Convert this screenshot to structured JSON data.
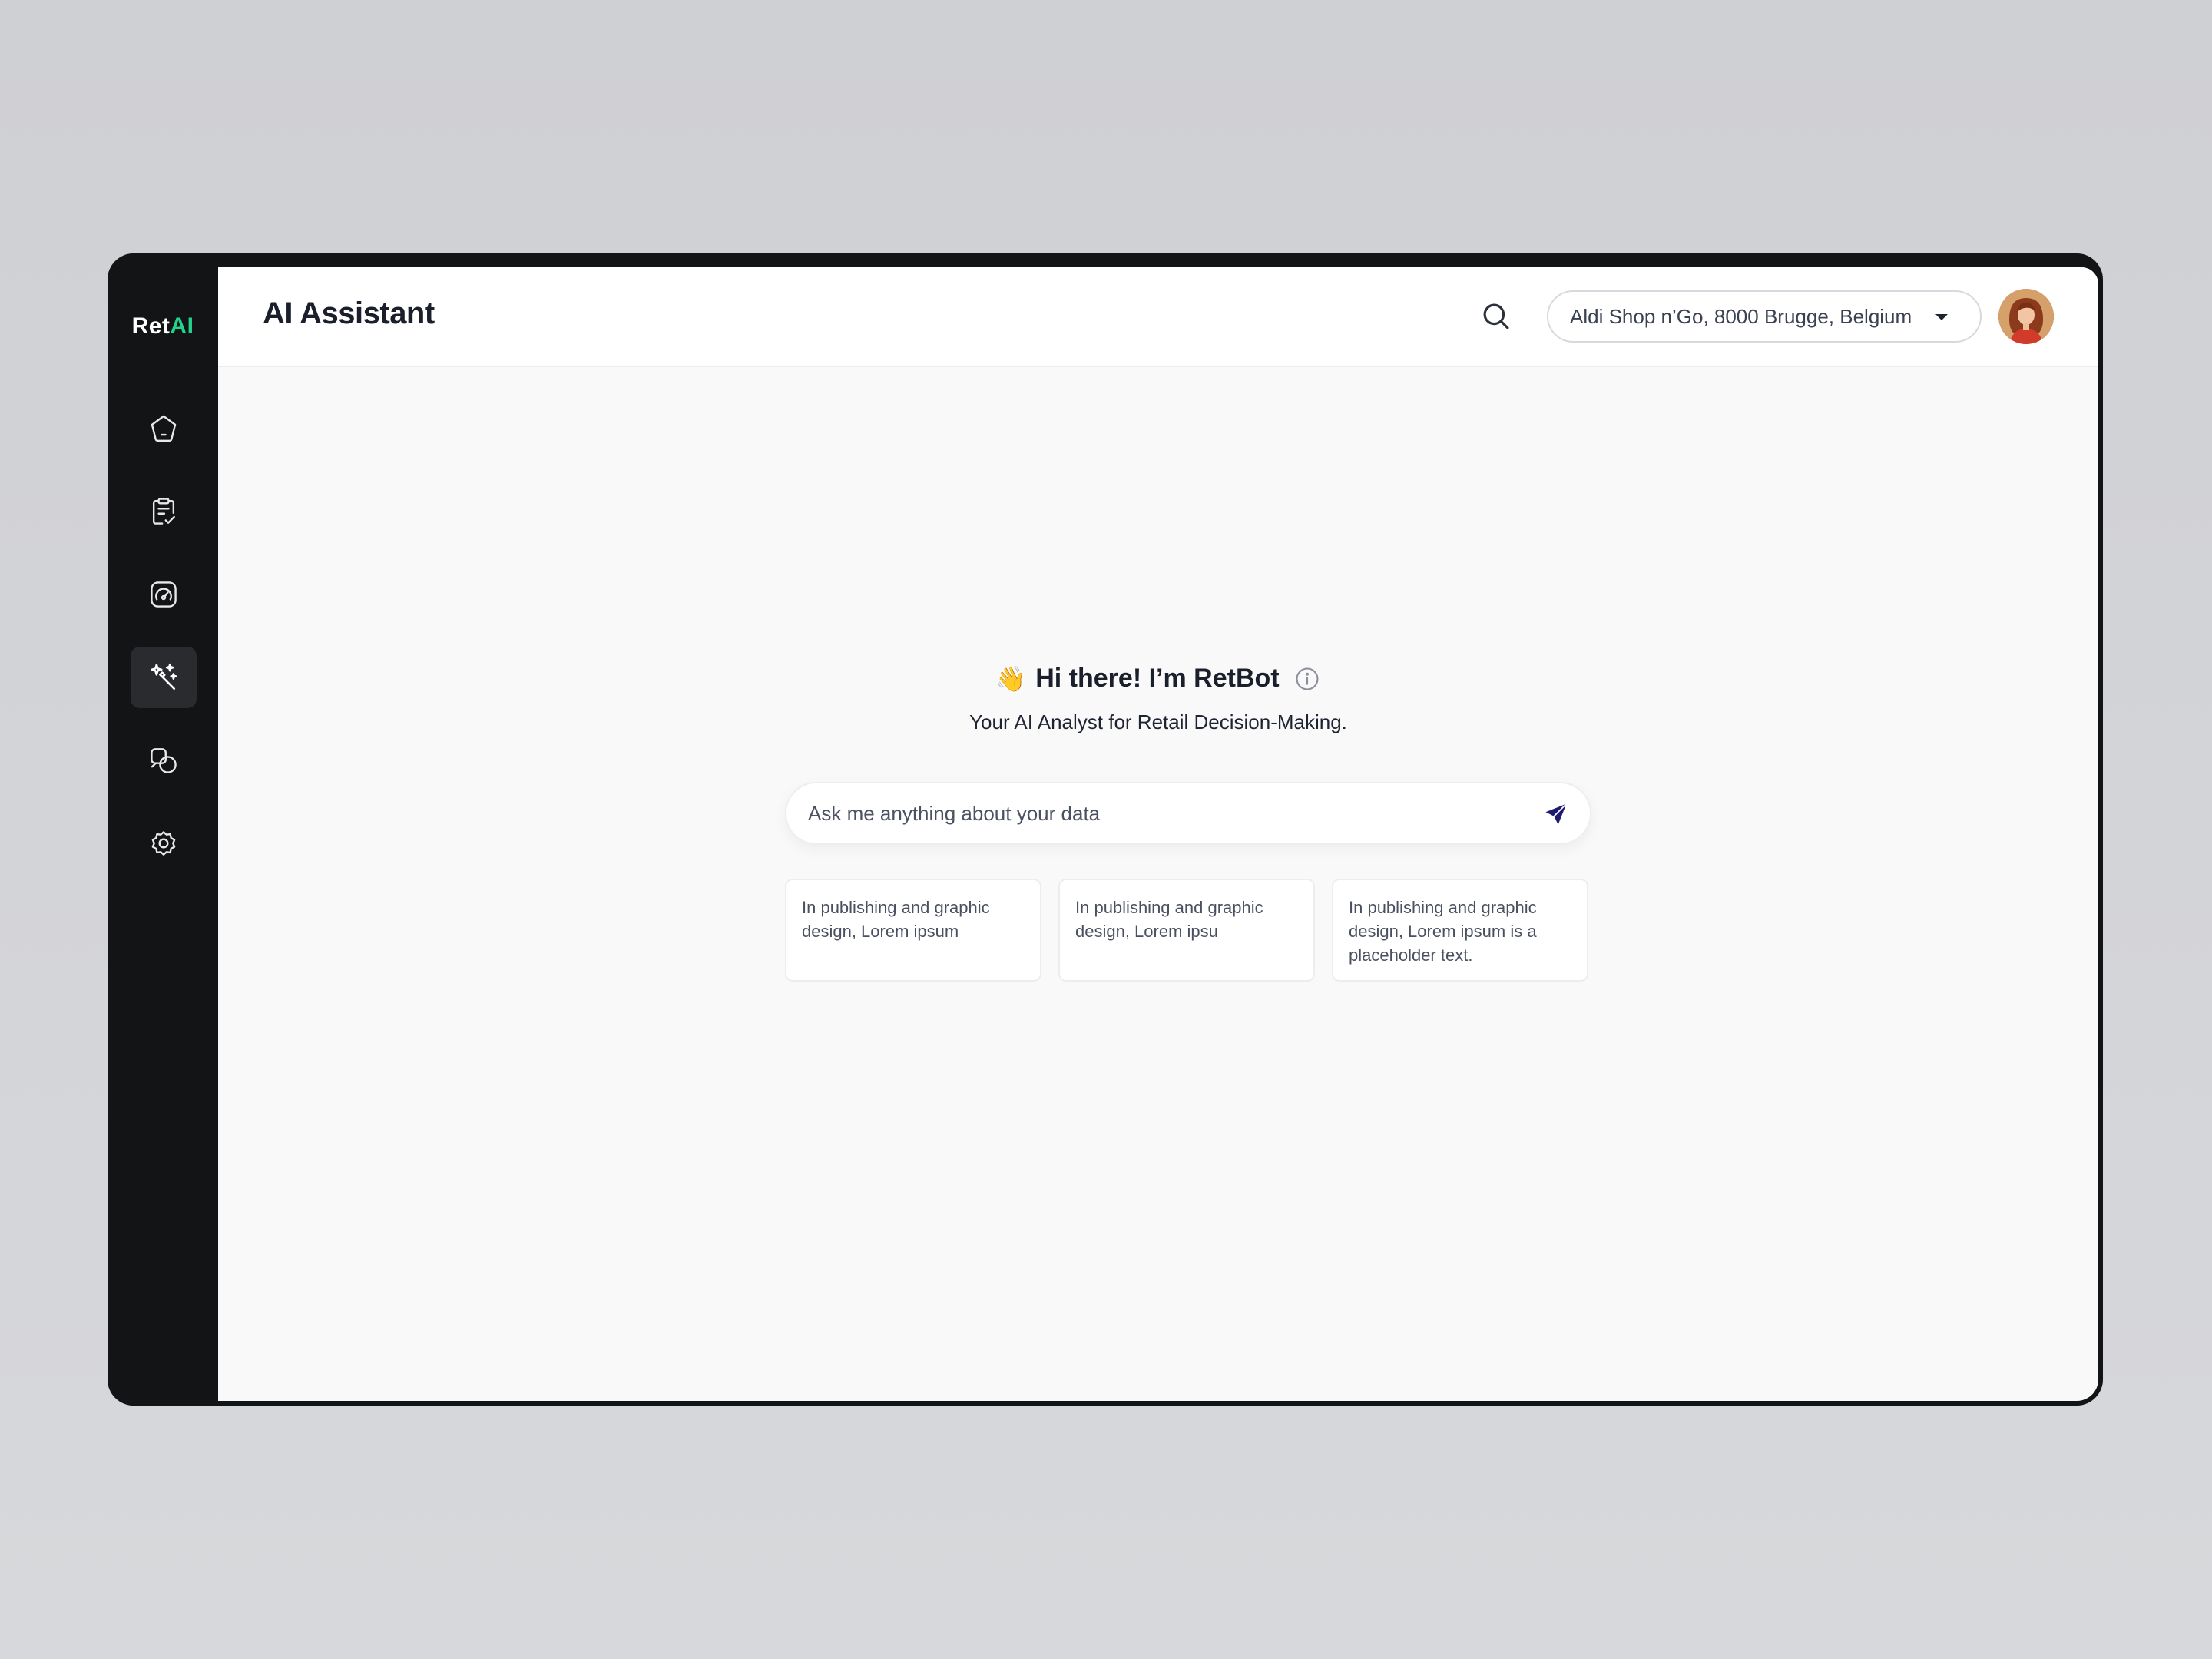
{
  "app": {
    "logo_prefix": "Ret",
    "logo_accent": "AI",
    "accent_color": "#22d38b"
  },
  "sidebar": {
    "items": [
      {
        "icon": "home-icon",
        "active": false
      },
      {
        "icon": "clipboard-check-icon",
        "active": false
      },
      {
        "icon": "gauge-icon",
        "active": false
      },
      {
        "icon": "magic-wand-icon",
        "active": true
      },
      {
        "icon": "shapes-icon",
        "active": false
      },
      {
        "icon": "settings-gear-icon",
        "active": false
      }
    ]
  },
  "header": {
    "title": "AI Assistant",
    "search_icon": "search-icon",
    "store_selector": {
      "value": "Aldi Shop n’Go, 8000 Brugge, Belgium"
    },
    "avatar_icon": "user-avatar"
  },
  "hero": {
    "wave": "👋",
    "title": "Hi there! I’m RetBot",
    "subtitle": "Your AI Analyst for Retail Decision-Making."
  },
  "ask": {
    "placeholder": "Ask me anything about your data",
    "send_icon": "send-icon",
    "send_color": "#1e1a6e"
  },
  "suggestions": [
    "In publishing and graphic design, Lorem ipsum",
    "In publishing and graphic design, Lorem ipsu",
    "In publishing and graphic design, Lorem ipsum is a placeholder text."
  ]
}
